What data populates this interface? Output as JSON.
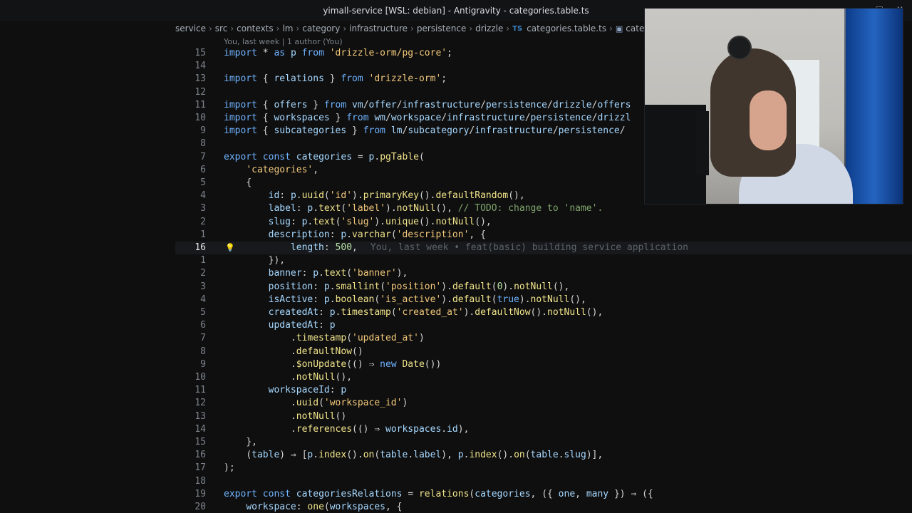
{
  "window": {
    "title": "yimall-service [WSL: debian] - Antigravity - categories.table.ts"
  },
  "breadcrumb": {
    "items": [
      "service",
      "src",
      "contexts",
      "lm",
      "category",
      "infrastructure",
      "persistence",
      "drizzle"
    ],
    "file": "categories.table.ts",
    "file_badge": "TS",
    "symbol": "categori"
  },
  "blame_header": "You, last week | 1 author (You)",
  "inline_blame": "You, last week • feat(basic) building service application",
  "lines": [
    {
      "n": "15",
      "code": "import * as p from 'drizzle-orm/pg-core';"
    },
    {
      "n": "14",
      "code": ""
    },
    {
      "n": "13",
      "code": "import { relations } from 'drizzle-orm';"
    },
    {
      "n": "12",
      "code": ""
    },
    {
      "n": "11",
      "code": "import { offers } from 'vm/offer/infrastructure/persistence/drizzle/offers"
    },
    {
      "n": "10",
      "code": "import { workspaces } from 'wm/workspace/infrastructure/persistence/drizzl"
    },
    {
      "n": "9",
      "code": "import { subcategories } from 'lm/subcategory/infrastructure/persistence/"
    },
    {
      "n": "8",
      "code": ""
    },
    {
      "n": "7",
      "code": "export const categories = p.pgTable("
    },
    {
      "n": "6",
      "code": "    'categories',"
    },
    {
      "n": "5",
      "code": "    {"
    },
    {
      "n": "4",
      "code": "        id: p.uuid('id').primaryKey().defaultRandom(),"
    },
    {
      "n": "3",
      "code": "        label: p.text('label').notNull(), // TODO: change to 'name'."
    },
    {
      "n": "2",
      "code": "        slug: p.text('slug').unique().notNull(),"
    },
    {
      "n": "1",
      "code": "        description: p.varchar('description', {"
    },
    {
      "n": "16",
      "code": "            length: 500,",
      "current": true
    },
    {
      "n": "1",
      "code": "        }),"
    },
    {
      "n": "2",
      "code": "        banner: p.text('banner'),"
    },
    {
      "n": "3",
      "code": "        position: p.smallint('position').default(0).notNull(),"
    },
    {
      "n": "4",
      "code": "        isActive: p.boolean('is_active').default(true).notNull(),"
    },
    {
      "n": "5",
      "code": "        createdAt: p.timestamp('created_at').defaultNow().notNull(),"
    },
    {
      "n": "6",
      "code": "        updatedAt: p"
    },
    {
      "n": "7",
      "code": "            .timestamp('updated_at')"
    },
    {
      "n": "8",
      "code": "            .defaultNow()"
    },
    {
      "n": "9",
      "code": "            .$onUpdate(() ⇒ new Date())"
    },
    {
      "n": "10",
      "code": "            .notNull(),"
    },
    {
      "n": "11",
      "code": "        workspaceId: p"
    },
    {
      "n": "12",
      "code": "            .uuid('workspace_id')"
    },
    {
      "n": "13",
      "code": "            .notNull()"
    },
    {
      "n": "14",
      "code": "            .references(() ⇒ workspaces.id),"
    },
    {
      "n": "15",
      "code": "    },"
    },
    {
      "n": "16",
      "code": "    (table) ⇒ [p.index().on(table.label), p.index().on(table.slug)],"
    },
    {
      "n": "17",
      "code": ");"
    },
    {
      "n": "18",
      "code": ""
    },
    {
      "n": "19",
      "code": "export const categoriesRelations = relations(categories, ({ one, many }) ⇒ ({"
    },
    {
      "n": "20",
      "code": "    workspace: one(workspaces, {"
    }
  ]
}
